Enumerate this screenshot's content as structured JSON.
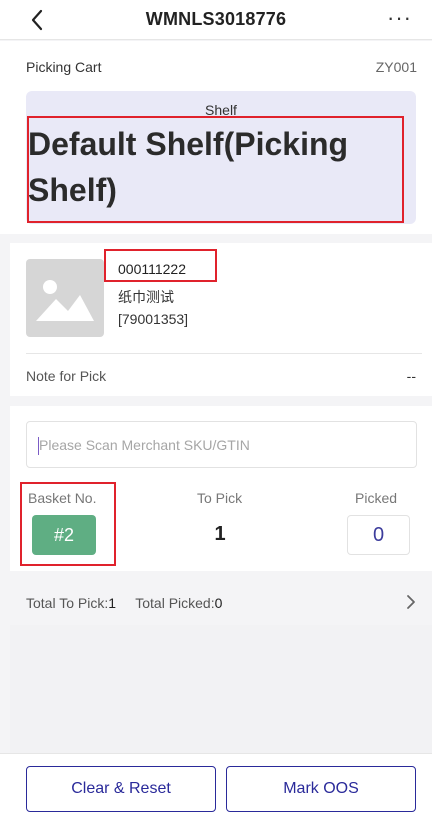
{
  "header": {
    "title": "WMNLS3018776",
    "more_label": "···"
  },
  "cart": {
    "label": "Picking Cart",
    "value": "ZY001"
  },
  "shelf": {
    "label": "Shelf",
    "name": "Default Shelf(Picking Shelf)"
  },
  "sku": {
    "code": "000111222",
    "name": "纸巾测试",
    "id": "[79001353]",
    "note_label": "Note for Pick",
    "note_value": "--"
  },
  "scan": {
    "placeholder": "Please Scan Merchant SKU/GTIN"
  },
  "pick_table": {
    "basket_title": "Basket No.",
    "topick_title": "To Pick",
    "picked_title": "Picked",
    "basket_value": "#2",
    "topick_value": "1",
    "picked_value": "0"
  },
  "totals": {
    "to_pick_label": "Total To Pick:",
    "to_pick_value": "1",
    "picked_label": "Total Picked:",
    "picked_value": "0"
  },
  "actions": {
    "clear_label": "Clear & Reset",
    "oos_label": "Mark OOS"
  },
  "colors": {
    "accent": "#2a2a9a",
    "basket": "#5fae83",
    "shelf_bg": "#e9e9f7",
    "highlight": "#e0222c"
  }
}
